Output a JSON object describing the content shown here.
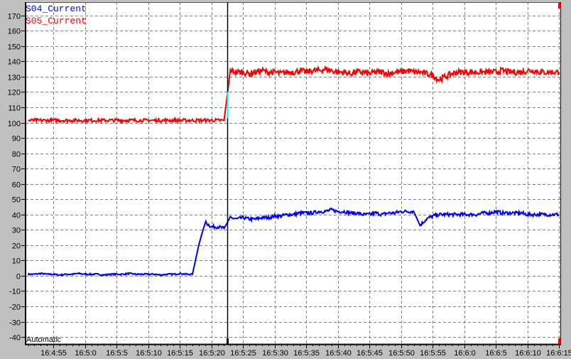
{
  "chart_data": {
    "type": "line",
    "title": "",
    "xlabel": "",
    "ylabel": "",
    "ylim": [
      -44.6,
      178.7
    ],
    "xlim": [
      "16:4:50.6",
      "16:6:15.2"
    ],
    "grid": true,
    "legend_placement": "top-left",
    "y_ticks": [
      "170",
      "160",
      "150",
      "140",
      "130",
      "120",
      "110",
      "100",
      "90",
      "80",
      "70",
      "60",
      "50",
      "40",
      "30",
      "20",
      "10",
      "0",
      "-10",
      "-20",
      "-30",
      "-40"
    ],
    "x_ticks": [
      "16:4:55",
      "16:5:0",
      "16:5:5",
      "16:5:10",
      "16:5:15",
      "16:5:20",
      "16:5:25",
      "16:5:30",
      "16:5:35",
      "16:5:40",
      "16:5:45",
      "16:5:50",
      "16:5:55",
      "16:6:0",
      "16:6:5",
      "16:6:10",
      "16:6:15"
    ],
    "x_start": "16:4:51",
    "sample_interval_s": 1,
    "cursor_time": "16:5:22.5",
    "mode_label": "Automatic",
    "series": [
      {
        "name": "S04_Current",
        "color": "#0000ff",
        "values": [
          1,
          1,
          1.5,
          1,
          1,
          0.5,
          1,
          1,
          1.5,
          1,
          1,
          1,
          0.5,
          1,
          1,
          1,
          1.5,
          1,
          1,
          1,
          1,
          0.5,
          1,
          1,
          1.5,
          1,
          1,
          20,
          35,
          32,
          32,
          31,
          38,
          37,
          38,
          37,
          37,
          38,
          38,
          39,
          39,
          40,
          40,
          41,
          41,
          41,
          42,
          42,
          43,
          42,
          42,
          41,
          41,
          40,
          40,
          41,
          40,
          41,
          41,
          42,
          42,
          42,
          33,
          37,
          39,
          40,
          40,
          40,
          40,
          40,
          40,
          40,
          41,
          41,
          42,
          41,
          41,
          41,
          41,
          40,
          40,
          40,
          40,
          40,
          40
        ]
      },
      {
        "name": "S05_Current",
        "color": "#ff0000",
        "values": [
          101.5,
          101.5,
          101.5,
          101.5,
          101.5,
          101.5,
          101.5,
          101.5,
          101.5,
          101.5,
          101.5,
          101.5,
          101.5,
          101.5,
          101.5,
          101.5,
          101.5,
          101.5,
          101.5,
          101.5,
          101.5,
          101.5,
          101.5,
          101.5,
          101.5,
          101.5,
          101.5,
          101.5,
          101.5,
          101.5,
          101.5,
          101.5,
          134,
          133,
          133,
          132,
          133,
          134,
          133,
          133,
          132,
          133,
          133,
          134,
          133,
          134,
          134,
          135,
          134,
          133,
          133,
          132,
          133,
          133,
          132,
          133,
          133,
          132,
          133,
          133,
          134,
          133,
          133,
          132,
          131,
          128,
          130,
          132,
          133,
          133,
          133,
          133,
          133,
          133,
          133,
          134,
          133,
          133,
          133,
          134,
          134,
          133,
          133,
          133,
          133
        ]
      }
    ]
  }
}
